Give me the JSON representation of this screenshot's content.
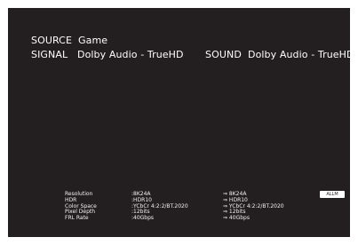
{
  "source": {
    "label": "SOURCE",
    "value": "Game"
  },
  "signal": {
    "label": "SIGNAL",
    "value": "Dolby Audio - TrueHD"
  },
  "sound": {
    "label": "SOUND",
    "value": "Dolby Audio - TrueHD"
  },
  "badge": {
    "label": "ALLM"
  },
  "info": {
    "rows": [
      {
        "key": "Resolution",
        "input": ":8K24A",
        "output": "⇒ 8K24A"
      },
      {
        "key": "HDR",
        "input": ":HDR10",
        "output": "⇒ HDR10"
      },
      {
        "key": "Color Space",
        "input": ":YCbCr 4:2:2/BT.2020",
        "output": "⇒ YCbCr 4:2:2/BT.2020"
      },
      {
        "key": "Pixel Depth",
        "input": ":12bits",
        "output": "⇒ 12bits"
      },
      {
        "key": "FRL Rate",
        "input": ":40Gbps",
        "output": "⇒ 40Gbps"
      }
    ]
  },
  "colors": {
    "background": "#231f20",
    "text": "#ffffff"
  }
}
